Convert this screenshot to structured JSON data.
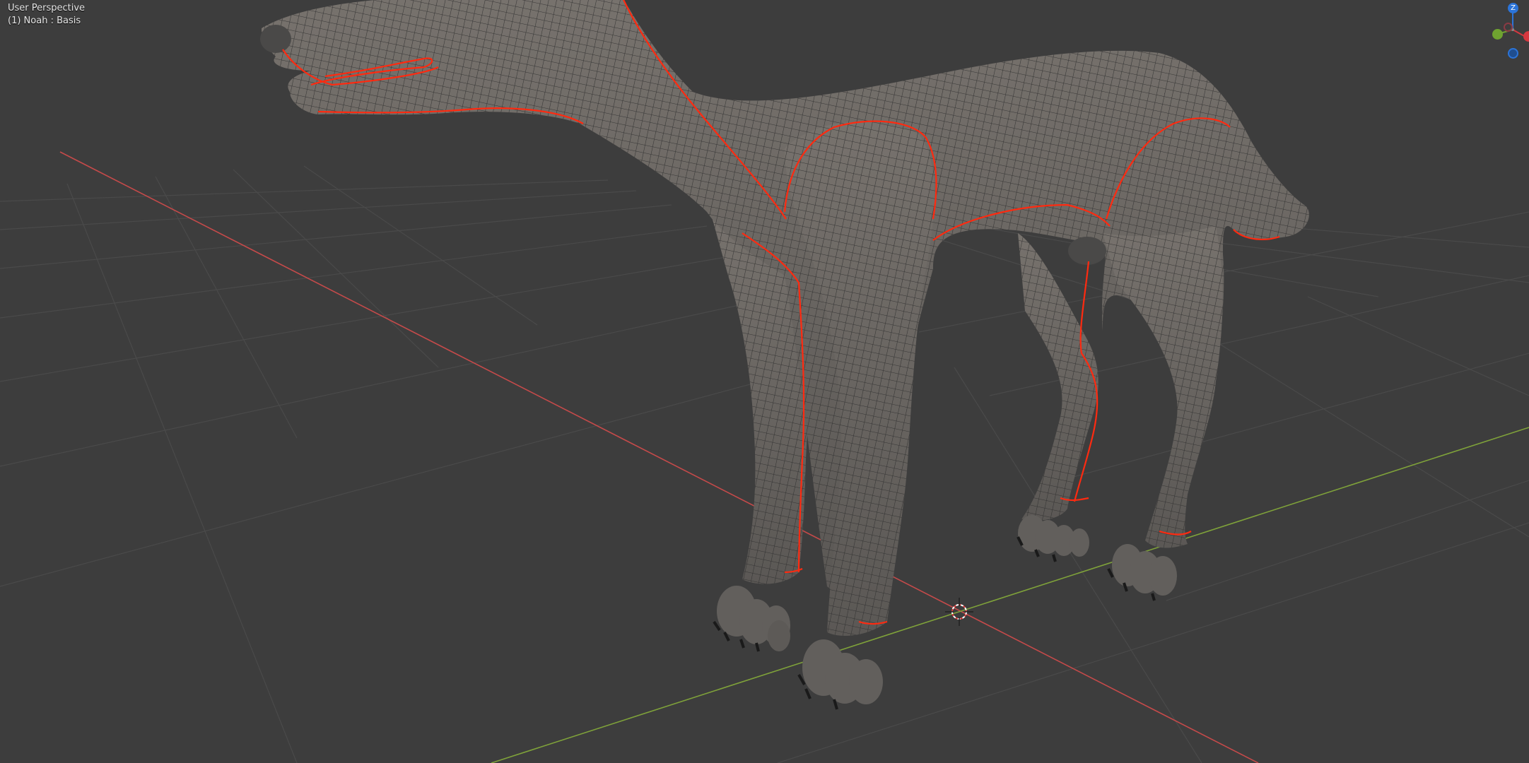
{
  "viewport": {
    "view_name": "User Perspective",
    "object_info": "(1) Noah : Basis",
    "colors": {
      "background": "#3d3d3d",
      "grid": "#4a4a4a",
      "x_axis": "#c54a4a",
      "y_axis": "#7fa23a",
      "mesh": "#686461",
      "wire": "#2e2e2e",
      "seam": "#ff2a10",
      "claw": "#1a1a1a"
    }
  },
  "gizmo": {
    "z_label": "Z",
    "z_color": "#2b74d9",
    "y_color": "#6fa330",
    "x_color": "#d6373f"
  },
  "scene": {
    "object_name": "Noah",
    "shape_key": "Basis",
    "model": "wolf-mesh"
  }
}
